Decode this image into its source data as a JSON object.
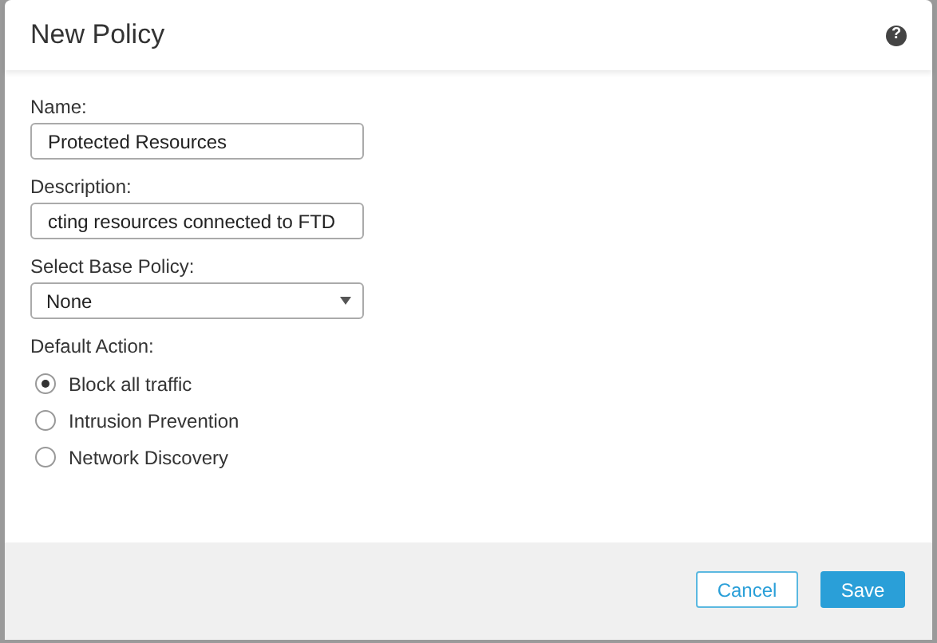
{
  "dialog": {
    "title": "New Policy",
    "help": "?"
  },
  "fields": [
    {
      "kind": "text",
      "label": "Name:",
      "value": "Protected Resources"
    },
    {
      "kind": "text",
      "label": "Description:",
      "value": "cting resources connected to FTD"
    },
    {
      "kind": "select",
      "label": "Select Base Policy:",
      "value": "None"
    }
  ],
  "default_action": {
    "label": "Default Action:",
    "options": [
      {
        "label": "Block all traffic",
        "selected": true
      },
      {
        "label": "Intrusion Prevention",
        "selected": false
      },
      {
        "label": "Network Discovery",
        "selected": false
      }
    ]
  },
  "buttons": [
    {
      "kind": "secondary",
      "label": "Cancel"
    },
    {
      "kind": "primary",
      "label": "Save"
    }
  ]
}
